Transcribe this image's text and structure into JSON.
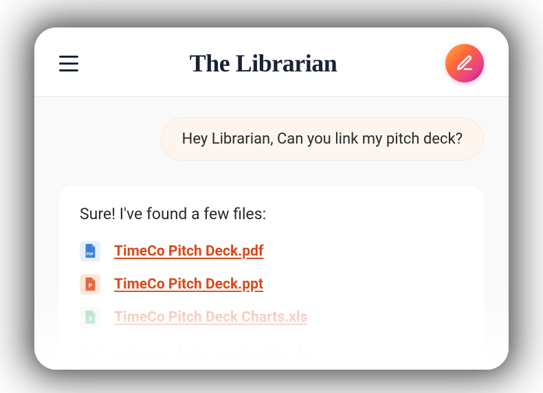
{
  "header": {
    "title": "The Librarian"
  },
  "chat": {
    "user_message": "Hey Librarian, Can you link my pitch deck?",
    "response_intro": "Sure! I've found a few files:",
    "files": [
      {
        "name": "TimeCo Pitch Deck.pdf",
        "type": "pdf"
      },
      {
        "name": "TimeCo Pitch Deck.ppt",
        "type": "ppt"
      },
      {
        "name": "TimeCo Pitch Deck Charts.xls",
        "type": "xls"
      }
    ],
    "response_footer": "Let me know if you are looking for"
  }
}
